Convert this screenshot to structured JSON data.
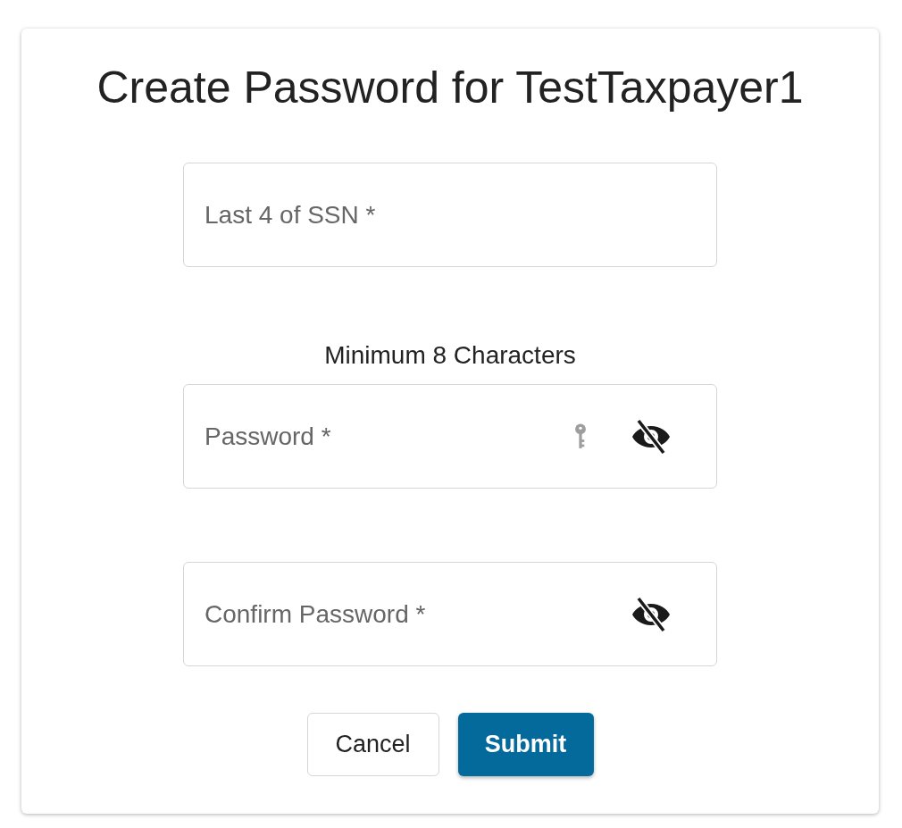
{
  "title": "Create Password for TestTaxpayer1",
  "fields": [
    {
      "kind": "text",
      "placeholder": "Last 4 of SSN *"
    },
    {
      "kind": "password",
      "hint": "Minimum 8 Characters",
      "placeholder": "Password *",
      "key_icon": true,
      "visible": false
    },
    {
      "kind": "password",
      "placeholder": "Confirm Password *",
      "key_icon": false,
      "visible": false
    }
  ],
  "buttons": [
    {
      "kind": "secondary",
      "label": "Cancel"
    },
    {
      "kind": "primary",
      "label": "Submit"
    }
  ]
}
